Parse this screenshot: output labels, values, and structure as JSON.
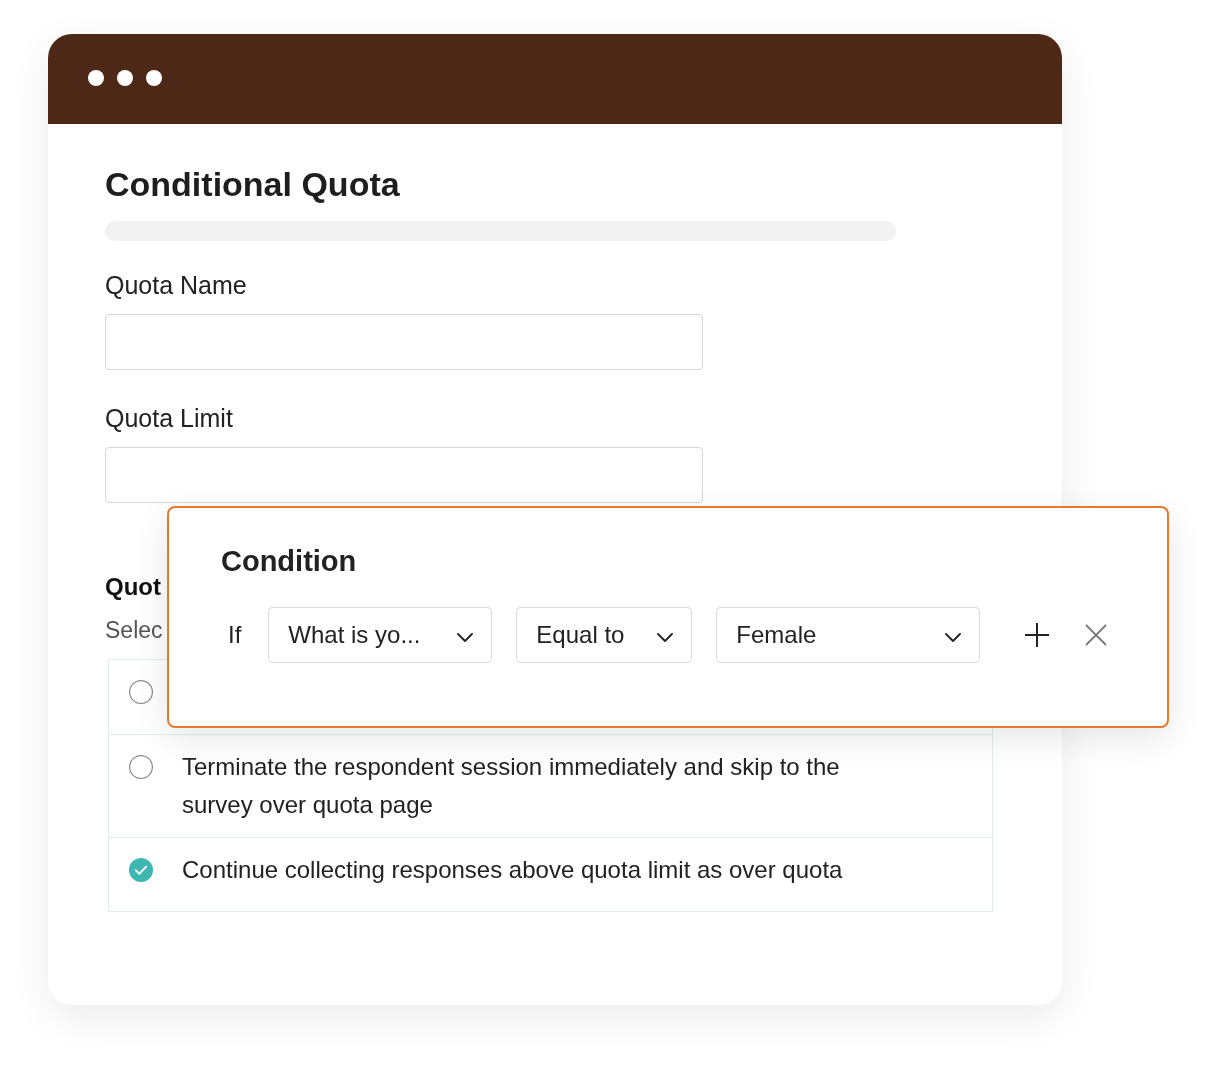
{
  "form": {
    "title": "Conditional Quota",
    "fields": [
      {
        "label": "Quota Name"
      },
      {
        "label": "Quota Limit"
      }
    ]
  },
  "quota_action": {
    "heading": "Quot",
    "hint": "Selec",
    "options": [
      {
        "selected": false
      },
      {
        "label": "Terminate the respondent session immediately and skip to the survey over quota page",
        "selected": false
      },
      {
        "label": "Continue collecting responses above quota limit as over quota",
        "selected": true
      }
    ]
  },
  "condition_popup": {
    "title": "Condition",
    "connector": "If",
    "selects": [
      {
        "value": "What is yo..."
      },
      {
        "value": "Equal to"
      },
      {
        "value": "Female"
      }
    ]
  }
}
